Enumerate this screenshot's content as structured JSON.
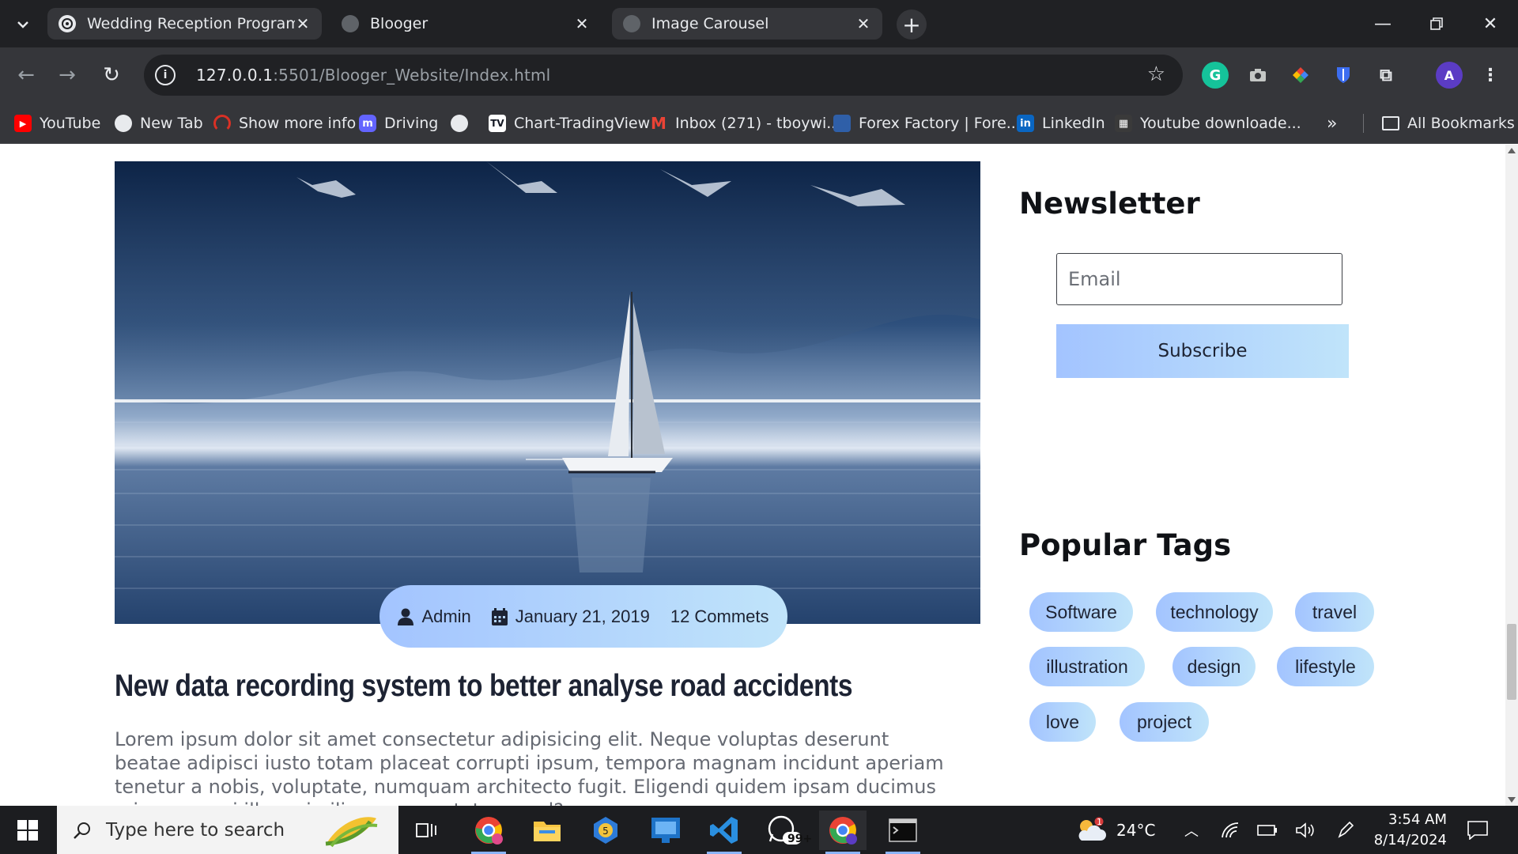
{
  "browser": {
    "tabs": [
      {
        "label": "Wedding Reception Program D",
        "active": true
      },
      {
        "label": "Blooger",
        "active": false
      },
      {
        "label": "Image Carousel",
        "active": true
      }
    ],
    "url_host": "127.0.0.1",
    "url_path": ":5501/Blooger_Website/Index.html",
    "profile_initial": "A",
    "bookmarks": [
      {
        "label": "YouTube",
        "icon": "youtube-icon"
      },
      {
        "label": "New Tab",
        "icon": "globe-icon"
      },
      {
        "label": "Show more info",
        "icon": "gauge-icon"
      },
      {
        "label": "Driving",
        "icon": "mastodon-icon"
      },
      {
        "label": "",
        "icon": "globe-icon"
      },
      {
        "label": "Chart-TradingView",
        "icon": "tradingview-icon"
      },
      {
        "label": "Inbox (271) - tboywi...",
        "icon": "gmail-icon"
      },
      {
        "label": "Forex Factory | Fore...",
        "icon": "forex-factory-icon"
      },
      {
        "label": "LinkedIn",
        "icon": "linkedin-icon"
      },
      {
        "label": "Youtube downloade...",
        "icon": "downloader-icon"
      }
    ],
    "all_bookmarks_label": "All Bookmarks",
    "overflow_label": "»"
  },
  "post": {
    "meta": {
      "author": "Admin",
      "date": "January 21, 2019",
      "comments": "12 Commets"
    },
    "title": "New data recording system to better analyse road accidents",
    "body": "Lorem ipsum dolor sit amet consectetur adipisicing elit. Neque voluptas deserunt beatae adipisci iusto totam placeat corrupti ipsum, tempora magnam incidunt aperiam tenetur a nobis, voluptate, numquam architecto fugit. Eligendi quidem ipsam ducimus minus magni illum similique consectetur quod?"
  },
  "sidebar": {
    "newsletter_heading": "Newsletter",
    "email_placeholder": "Email",
    "subscribe_label": "Subscribe",
    "tags_heading": "Popular Tags",
    "tags": [
      "Software",
      "technology",
      "travel",
      "illustration",
      "design",
      "lifestyle",
      "love",
      "project"
    ]
  },
  "taskbar": {
    "search_placeholder": "Type here to search",
    "weather_temp": "24°C",
    "weather_badge": "1",
    "whatsapp_badge": "99+",
    "time": "3:54 AM",
    "date": "8/14/2024"
  },
  "colors": {
    "accent_gradient_start": "#a3c4ff",
    "accent_gradient_end": "#c0e4fa",
    "heading": "#101216",
    "body_text": "#666a73"
  }
}
